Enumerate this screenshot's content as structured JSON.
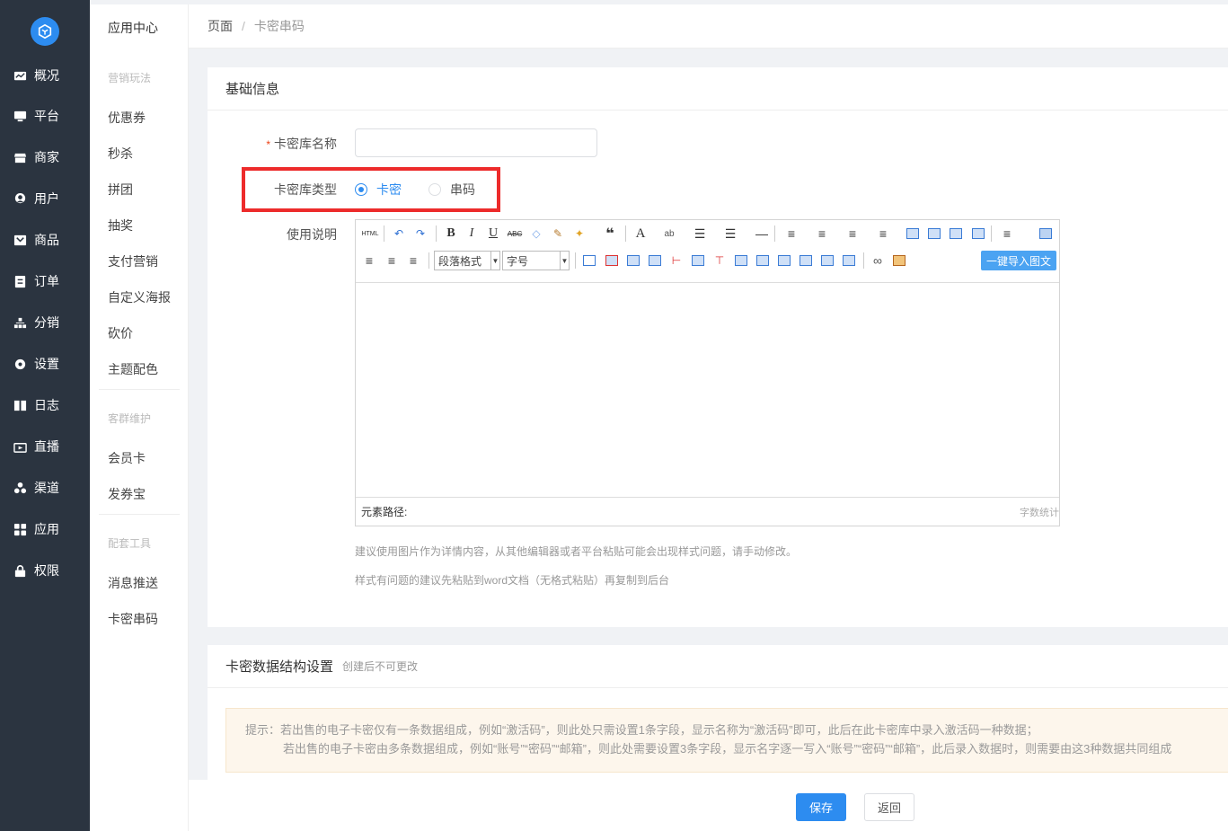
{
  "nav": {
    "items": [
      {
        "label": "概况",
        "icon": "chart-icon"
      },
      {
        "label": "平台",
        "icon": "monitor-icon"
      },
      {
        "label": "商家",
        "icon": "store-icon"
      },
      {
        "label": "用户",
        "icon": "user-icon"
      },
      {
        "label": "商品",
        "icon": "goods-icon"
      },
      {
        "label": "订单",
        "icon": "order-icon"
      },
      {
        "label": "分销",
        "icon": "sitemap-icon"
      },
      {
        "label": "设置",
        "icon": "gear-icon"
      },
      {
        "label": "日志",
        "icon": "book-icon"
      },
      {
        "label": "直播",
        "icon": "tv-icon"
      },
      {
        "label": "渠道",
        "icon": "channel-icon"
      },
      {
        "label": "应用",
        "icon": "grid-icon"
      },
      {
        "label": "权限",
        "icon": "lock-icon"
      }
    ]
  },
  "submenu": {
    "title": "应用中心",
    "groups": [
      {
        "label": "营销玩法",
        "links": [
          "优惠券",
          "秒杀",
          "拼团",
          "抽奖",
          "支付营销",
          "自定义海报",
          "砍价",
          "主题配色"
        ]
      },
      {
        "label": "客群维护",
        "links": [
          "会员卡",
          "发券宝"
        ]
      },
      {
        "label": "配套工具",
        "links": [
          "消息推送",
          "卡密串码"
        ]
      }
    ]
  },
  "breadcrumb": {
    "root": "页面",
    "separator": "/",
    "current": "卡密串码"
  },
  "basic": {
    "header": "基础信息",
    "name_label": "卡密库名称",
    "required_mark": "*",
    "name_value": "",
    "type_label": "卡密库类型",
    "type_options": [
      "卡密",
      "串码"
    ],
    "type_selected": "卡密",
    "desc_label": "使用说明",
    "editor": {
      "html_btn": "HTML",
      "paragraph_select": "段落格式",
      "fontsize_select": "字号",
      "import_btn": "一键导入图文",
      "path_label": "元素路径:",
      "word_count": "字数统计"
    },
    "hint1": "建议使用图片作为详情内容，从其他编辑器或者平台粘贴可能会出现样式问题，请手动修改。",
    "hint2": "样式有问题的建议先粘贴到word文档（无格式粘贴）再复制到后台"
  },
  "structure": {
    "header": "卡密数据结构设置",
    "subheader": "创建后不可更改",
    "tip_prefix": "提示：",
    "tip_line1": "若出售的电子卡密仅有一条数据组成，例如“激活码”，则此处只需设置1条字段，显示名称为“激活码”即可，此后在此卡密库中录入激活码一种数据；",
    "tip_line2": "若出售的电子卡密由多条数据组成，例如“账号”“密码”“邮箱”，则此处需要设置3条字段，显示名字逐一写入“账号”“密码”“邮箱”，此后录入数据时，则需要由这3种数据共同组成"
  },
  "actions": {
    "save": "保存",
    "back": "返回"
  },
  "colors": {
    "sidebar": "#2b3440",
    "primary": "#2d8cf0",
    "highlight": "#ed2b2b"
  }
}
